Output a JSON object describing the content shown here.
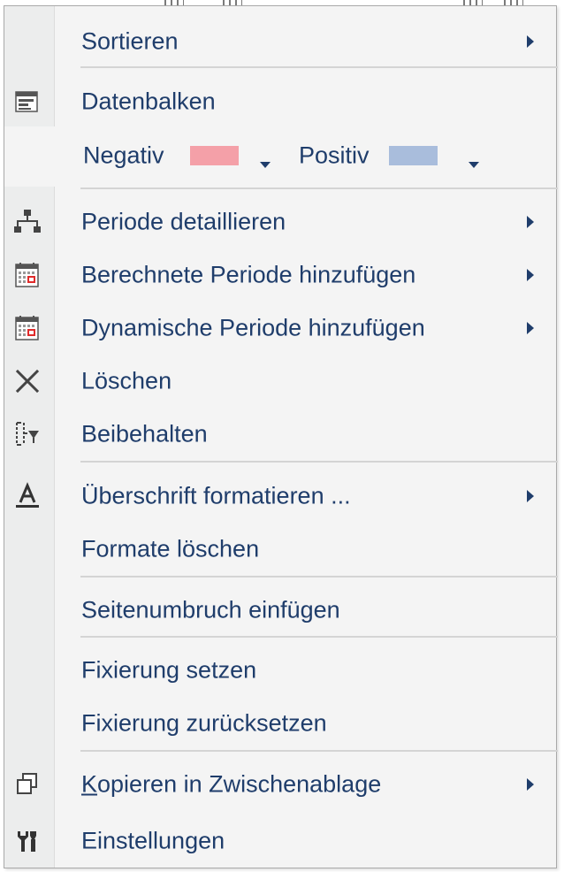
{
  "menu": {
    "sortieren": "Sortieren",
    "datenbalken": "Datenbalken",
    "negativ_label": "Negativ",
    "negativ_color": "#f4a0a8",
    "positiv_label": "Positiv",
    "positiv_color": "#a9bddc",
    "periode_detaillieren": "Periode detaillieren",
    "berechnete_periode": "Berechnete Periode hinzufügen",
    "dynamische_periode": "Dynamische Periode hinzufügen",
    "loeschen": "Löschen",
    "beibehalten": "Beibehalten",
    "ueberschrift_formatieren": "Überschrift formatieren ...",
    "formate_loeschen": "Formate löschen",
    "seitenumbruch": "Seitenumbruch einfügen",
    "fixierung_setzen": "Fixierung setzen",
    "fixierung_zuruecksetzen": "Fixierung zurücksetzen",
    "kopieren_access_key": "K",
    "kopieren_rest": "opieren in Zwischenablage",
    "einstellungen": "Einstellungen"
  },
  "icons": {
    "datenbalken": "data-bars-icon",
    "periode_detaillieren": "hierarchy-icon",
    "berechnete_periode": "calendar-icon",
    "dynamische_periode": "calendar-icon",
    "loeschen": "close-x-icon",
    "beibehalten": "keep-filter-icon",
    "ueberschrift_formatieren": "text-format-icon",
    "kopieren": "copy-icon",
    "einstellungen": "tools-icon"
  }
}
